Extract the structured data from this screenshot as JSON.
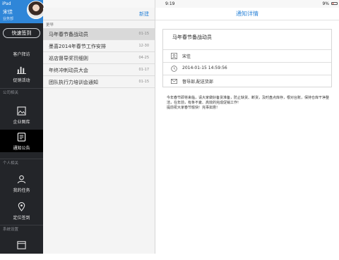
{
  "status": {
    "device": "iPad",
    "time": "9:19",
    "battery": "9%"
  },
  "profile": {
    "name": "宋佳",
    "role": "业务部"
  },
  "sidebar": {
    "quick_sign": "快速签到",
    "items": [
      {
        "label": "客户拜访",
        "icon": "customer-visit-icon"
      },
      {
        "label": "促销活动",
        "icon": "bar-chart-icon"
      },
      {
        "label": "企业图库",
        "icon": "picture-icon"
      },
      {
        "label": "通知公告",
        "icon": "notice-icon"
      },
      {
        "label": "我的任务",
        "icon": "person-icon"
      },
      {
        "label": "定位签到",
        "icon": "location-pin-icon"
      },
      {
        "label": "",
        "icon": "calendar-icon"
      }
    ],
    "sections": {
      "company": "公司相关",
      "personal": "个人相关",
      "system": "系统设置"
    }
  },
  "list": {
    "new_label": "新建",
    "section_label": "更早",
    "rows": [
      {
        "title": "马年春节备战动员",
        "date": "01-15",
        "selected": true
      },
      {
        "title": "墨喜2014年春节工作安排",
        "date": "12-30",
        "selected": false
      },
      {
        "title": "巡店督导奖罚细则",
        "date": "04-25",
        "selected": false
      },
      {
        "title": "年终冲刺动员大会",
        "date": "01-17",
        "selected": false
      },
      {
        "title": "团队执行力培训会通知",
        "date": "01-15",
        "selected": false
      }
    ]
  },
  "detail": {
    "header": "通知详情",
    "notice_title": "马年春节备战动员",
    "author": "宋佳",
    "datetime": "2014-01-15 14:59:56",
    "recipients": "督导部,配送货部",
    "content": "今年春节即将来临，请大家做好备货准备，防止缺货、断货，及时盘点库存，根对台账，保持仓库干净整洁，在年前，有条不紊、高效的完成促销工作!\n提前祝大家春节愉快!  完事如意!"
  },
  "colors": {
    "accent": "#2f86d8",
    "sidebar": "#232529"
  }
}
